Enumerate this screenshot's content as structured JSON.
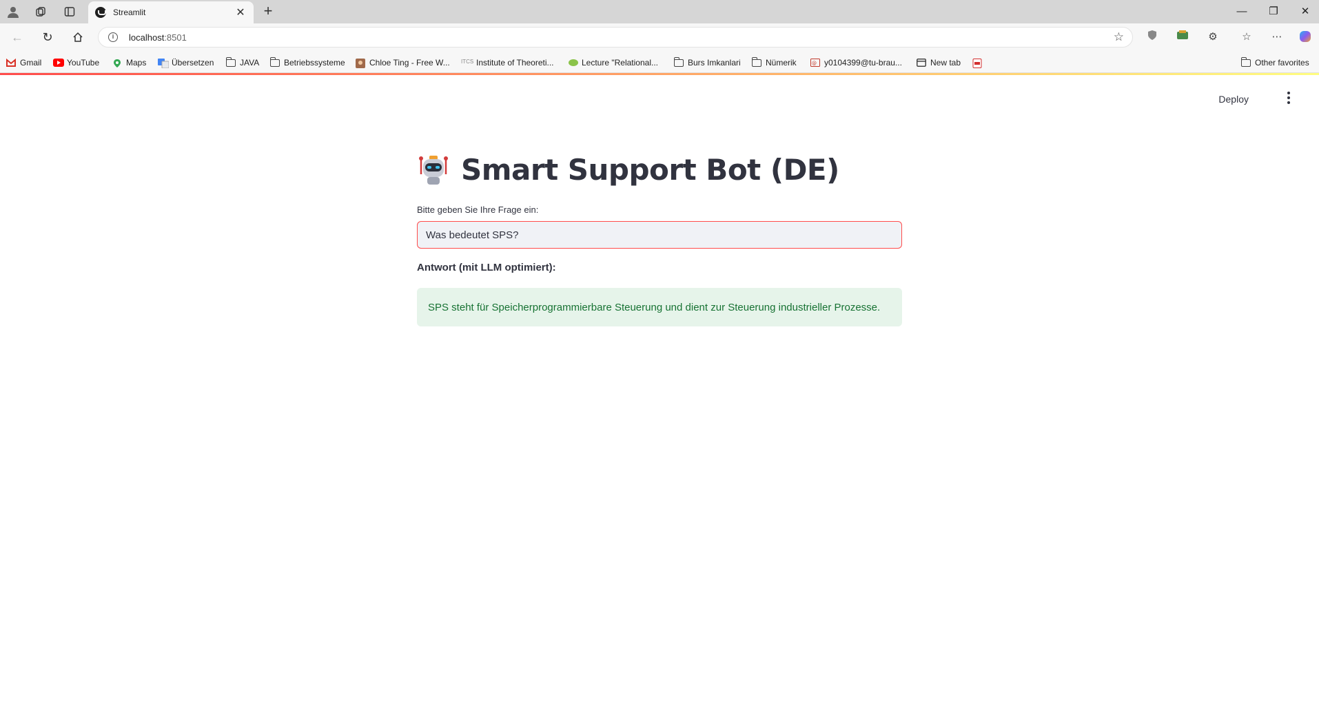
{
  "browser": {
    "tab_title": "Streamlit",
    "url_host": "localhost",
    "url_port": ":8501",
    "bookmarks": [
      {
        "label": "Gmail",
        "icon": "gmail-icon"
      },
      {
        "label": "YouTube",
        "icon": "youtube-icon"
      },
      {
        "label": "Maps",
        "icon": "maps-icon"
      },
      {
        "label": "Übersetzen",
        "icon": "translate-icon"
      },
      {
        "label": "JAVA",
        "icon": "folder-icon"
      },
      {
        "label": "Betriebssysteme",
        "icon": "folder-icon"
      },
      {
        "label": "Chloe Ting - Free W...",
        "icon": "avatar-icon"
      },
      {
        "label": "Institute of Theoreti...",
        "icon": "site-icon"
      },
      {
        "label": "Lecture \"Relational...",
        "icon": "site-icon"
      },
      {
        "label": "Burs Imkanlari",
        "icon": "folder-icon"
      },
      {
        "label": "Nümerik",
        "icon": "folder-icon"
      },
      {
        "label": "y0104399@tu-brau...",
        "icon": "mail-icon"
      },
      {
        "label": "New tab",
        "icon": "newtab-icon"
      },
      {
        "label": "",
        "icon": "pdf-icon"
      }
    ],
    "other_favorites": "Other favorites"
  },
  "app": {
    "deploy_label": "Deploy",
    "title": "Smart Support Bot (DE)",
    "input_label": "Bitte geben Sie Ihre Frage ein:",
    "input_value": "Was bedeutet SPS?",
    "answer_label": "Antwort (mit LLM optimiert):",
    "answer_text": "SPS steht für Speicherprogrammierbare Steuerung und dient zur Steuerung industrieller Prozesse."
  },
  "colors": {
    "accent": "#ff4b4b",
    "success_bg": "#e6f4ea",
    "success_text": "#177233",
    "text": "#31333f"
  }
}
